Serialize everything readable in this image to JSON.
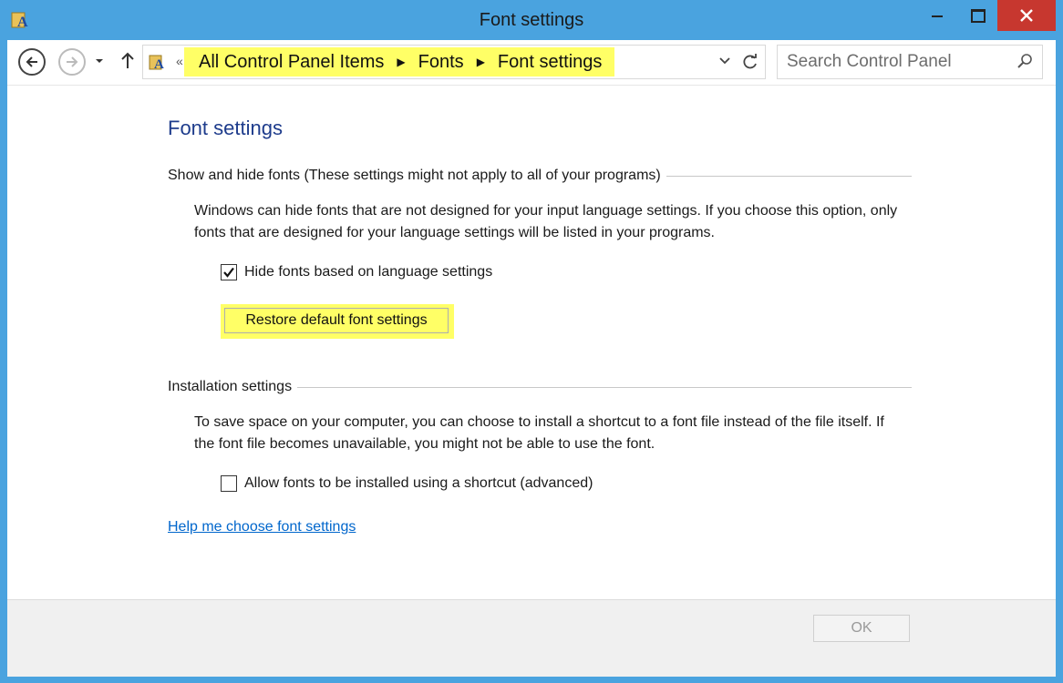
{
  "window": {
    "title": "Font settings",
    "colors": {
      "frame": "#4aa3df",
      "close": "#c7372f",
      "highlight": "#ffff66",
      "title_blue": "#1e3c8c",
      "link": "#0066cc"
    }
  },
  "navigation": {
    "breadcrumb_overflow": "«",
    "breadcrumbs": [
      "All Control Panel Items",
      "Fonts",
      "Font settings"
    ],
    "search_placeholder": "Search Control Panel"
  },
  "content": {
    "title": "Font settings",
    "show_hide": {
      "header": "Show and hide fonts (These settings might not apply to all of your programs)",
      "description": "Windows can hide fonts that are not designed for your input language settings. If you choose this option, only fonts that are designed for your language settings will be listed in your programs.",
      "checkbox_label": "Hide fonts based on language settings",
      "checked": true,
      "restore_button": "Restore default font settings"
    },
    "installation": {
      "header": "Installation settings",
      "description": "To save space on your computer, you can choose to install a shortcut to a font file instead of the file itself. If the font file becomes unavailable, you might not be able to use the font.",
      "checkbox_label": "Allow fonts to be installed using a shortcut (advanced)",
      "checked": false
    },
    "help_link": "Help me choose font settings"
  },
  "footer": {
    "ok_label": "OK"
  }
}
